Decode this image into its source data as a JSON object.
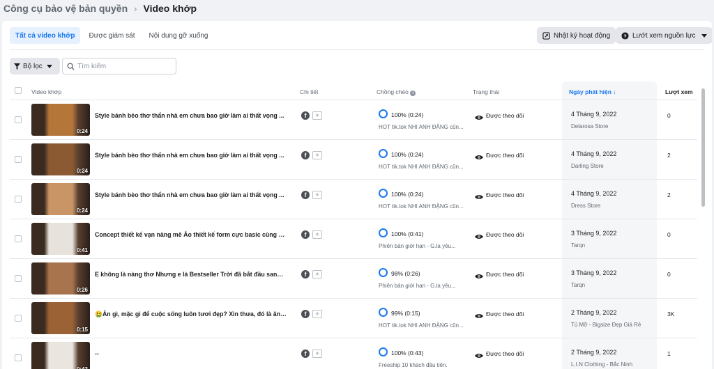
{
  "breadcrumb": {
    "parent": "Công cụ bảo vệ bản quyền",
    "current": "Video khớp"
  },
  "tabs": [
    {
      "label": "Tất cả video khớp",
      "active": true
    },
    {
      "label": "Được giám sát",
      "active": false
    },
    {
      "label": "Nội dung gỡ xuống",
      "active": false
    }
  ],
  "toolbar": {
    "activity_log": "Nhật ký hoạt động",
    "browse_sources": "Lướt xem nguồn lực"
  },
  "filter": {
    "label": "Bộ lọc"
  },
  "search": {
    "placeholder": "Tìm kiếm"
  },
  "columns": {
    "video": "Video khớp",
    "details": "Chi tiết",
    "overlap": "Chồng chéo",
    "status": "Trạng thái",
    "date": "Ngày phát hiện ↓",
    "views": "Lượt xem"
  },
  "colors": {
    "accent": "#1877f2",
    "thumb_palette": [
      "#b5763a",
      "#8c5a32",
      "#c99566",
      "#e8e2dc",
      "#a8744d",
      "#9a6235",
      "#ebe5df"
    ]
  },
  "rows": [
    {
      "title": "Style bánh bèo thơ thẩn nhà em chưa bao giờ làm ai thất vọng ...",
      "duration": "0:24",
      "overlap": "100% (0:24)",
      "source": "HOT tik.tok NHI ANH ĐẶNG cũn...",
      "status": "Được theo dõi",
      "date": "4 Tháng 9, 2022",
      "store": "Delarosa Store",
      "views": "0"
    },
    {
      "title": "Style bánh bèo thơ thẩn nhà em chưa bao giờ làm ai thất vọng ...",
      "duration": "0:24",
      "overlap": "100% (0:24)",
      "source": "HOT tik.tok NHI ANH ĐẶNG cũn...",
      "status": "Được theo dõi",
      "date": "4 Tháng 9, 2022",
      "store": "Darling Store",
      "views": "2"
    },
    {
      "title": "Style bánh bèo thơ thẩn nhà em chưa bao giờ làm ai thất vọng ...",
      "duration": "0:24",
      "overlap": "100% (0:24)",
      "source": "HOT tik.tok NHI ANH ĐẶNG cũn...",
      "status": "Được theo dõi",
      "date": "4 Tháng 9, 2022",
      "store": "Dress Store",
      "views": "2"
    },
    {
      "title": "Concept thiết kế vạn nàng mê Áo thiết kế form cực basic cùng ch...",
      "duration": "0:41",
      "overlap": "100% (0:41)",
      "source": "Phiên bản giới hạn - G.la yêu...",
      "status": "Được theo dõi",
      "date": "3 Tháng 9, 2022",
      "store": "Tarqn",
      "views": "0"
    },
    {
      "title": "E không là nàng thơ Nhưng e là Bestseller Trời đã bắt đầu sang t...",
      "duration": "0:26",
      "overlap": "98% (0:26)",
      "source": "Phiên bản giới hạn - G.la yêu...",
      "status": "Được theo dõi",
      "date": "3 Tháng 9, 2022",
      "store": "Tarqn",
      "views": "0"
    },
    {
      "title": "🤮Ăn gì, mặc gì để cuộc sống luôn tươi đẹp? Xin thưa, đó là ăn ả...",
      "duration": "0:15",
      "overlap": "99% (0:15)",
      "source": "HOT tik.tok NHI ANH ĐẶNG cũn...",
      "status": "Được theo dõi",
      "date": "2 Tháng 9, 2022",
      "store": "Tủ Mỡ - Bigsize Đẹp Giá Rẻ",
      "views": "3K"
    },
    {
      "title": "--",
      "duration": "0:43",
      "overlap": "100% (0:43)",
      "source": "Freeship 10 khách đầu tiên.",
      "status": "Được theo dõi",
      "date": "2 Tháng 9, 2022",
      "store": "L.I.N Clothing - Bắc Ninh",
      "views": "1"
    }
  ]
}
